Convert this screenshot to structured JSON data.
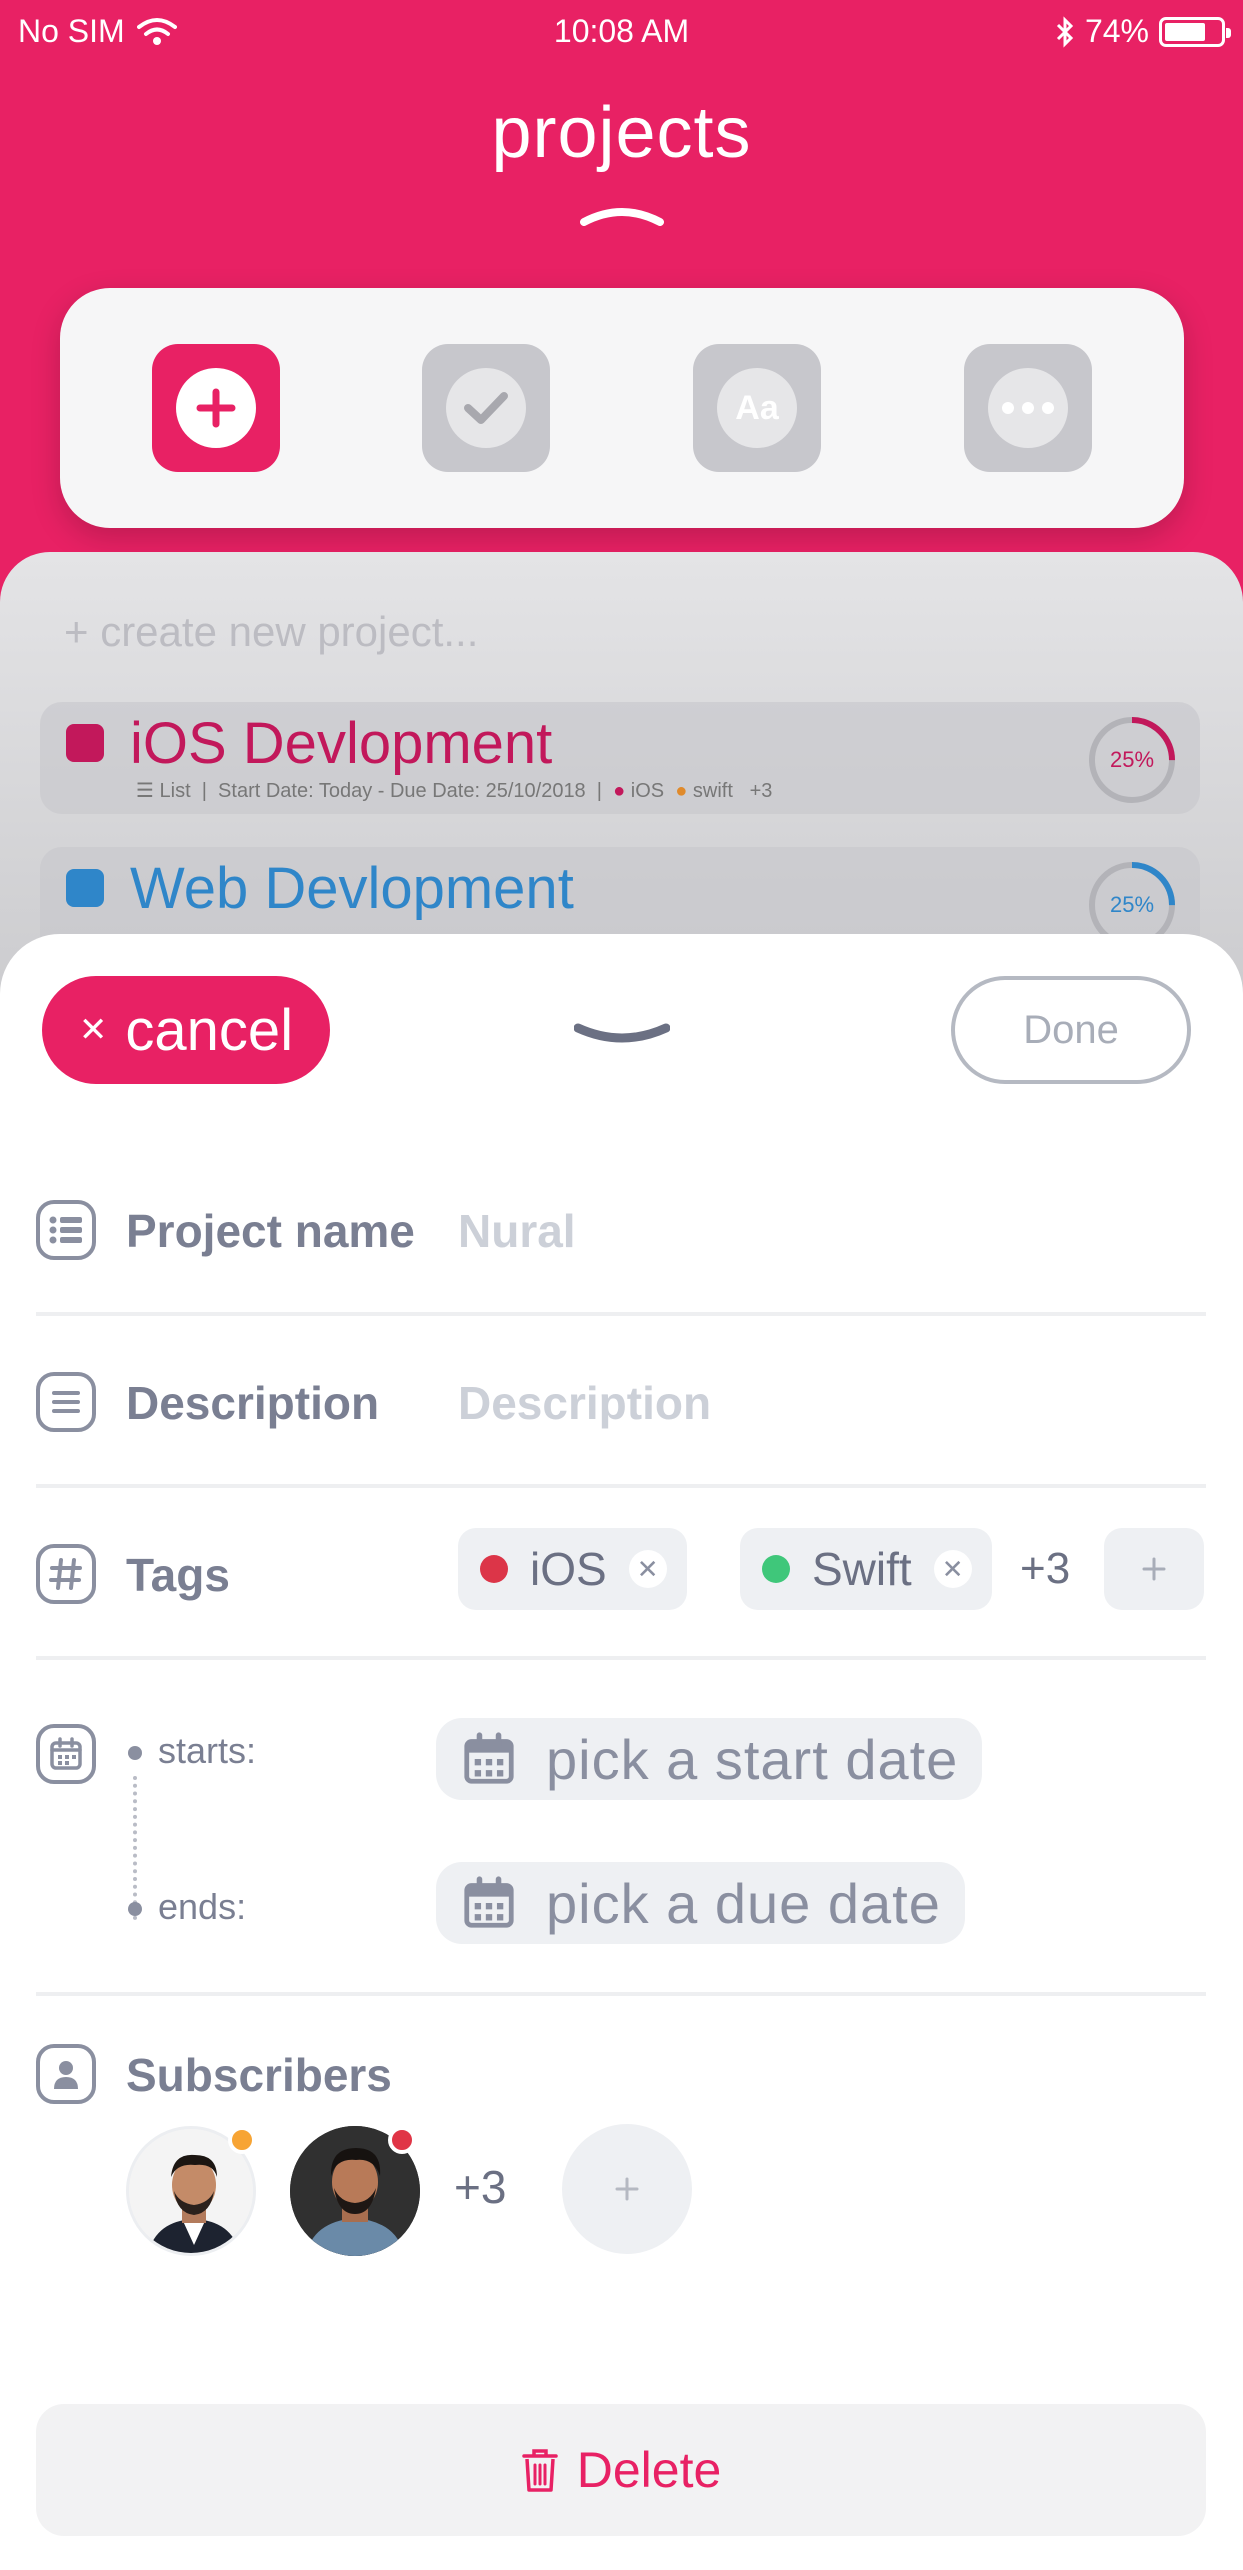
{
  "status_bar": {
    "carrier": "No SIM",
    "time": "10:08 AM",
    "battery": "74%",
    "battery_level": 0.74
  },
  "header": {
    "title": "projects"
  },
  "toolbar": {
    "tools": [
      "add-icon",
      "check-icon",
      "text-format-icon",
      "more-icon"
    ],
    "text_icon_label": "Aa"
  },
  "project_list": {
    "create_placeholder": "+ create new project...",
    "projects": [
      {
        "name": "iOS Devlopment",
        "color": "#c2185b",
        "view": "List",
        "dates": "Start Date: Today - Due Date: 25/10/2018",
        "tags": [
          "iOS",
          "swift"
        ],
        "tag_colors": [
          "#c2185b",
          "#e08a2b"
        ],
        "more": "+3",
        "progress": "25%",
        "progress_fraction": 0.25
      },
      {
        "name": "Web Devlopment",
        "color": "#2f86c9",
        "progress": "25%",
        "progress_fraction": 0.25
      }
    ]
  },
  "form": {
    "cancel_label": "cancel",
    "done_label": "Done",
    "project_name_label": "Project name",
    "project_name_value": "Nural",
    "description_label": "Description",
    "description_placeholder": "Description",
    "tags_label": "Tags",
    "tags": [
      {
        "name": "iOS",
        "color": "#dc3548"
      },
      {
        "name": "Swift",
        "color": "#3fc77a"
      }
    ],
    "tags_more": "+3",
    "starts_label": "starts:",
    "ends_label": "ends:",
    "start_placeholder": "pick a start date",
    "due_placeholder": "pick a due date",
    "subscribers_label": "Subscribers",
    "subscribers": [
      {
        "status_color": "#f7a434"
      },
      {
        "status_color": "#e03546"
      }
    ],
    "subscribers_more": "+3",
    "delete_label": "Delete"
  }
}
